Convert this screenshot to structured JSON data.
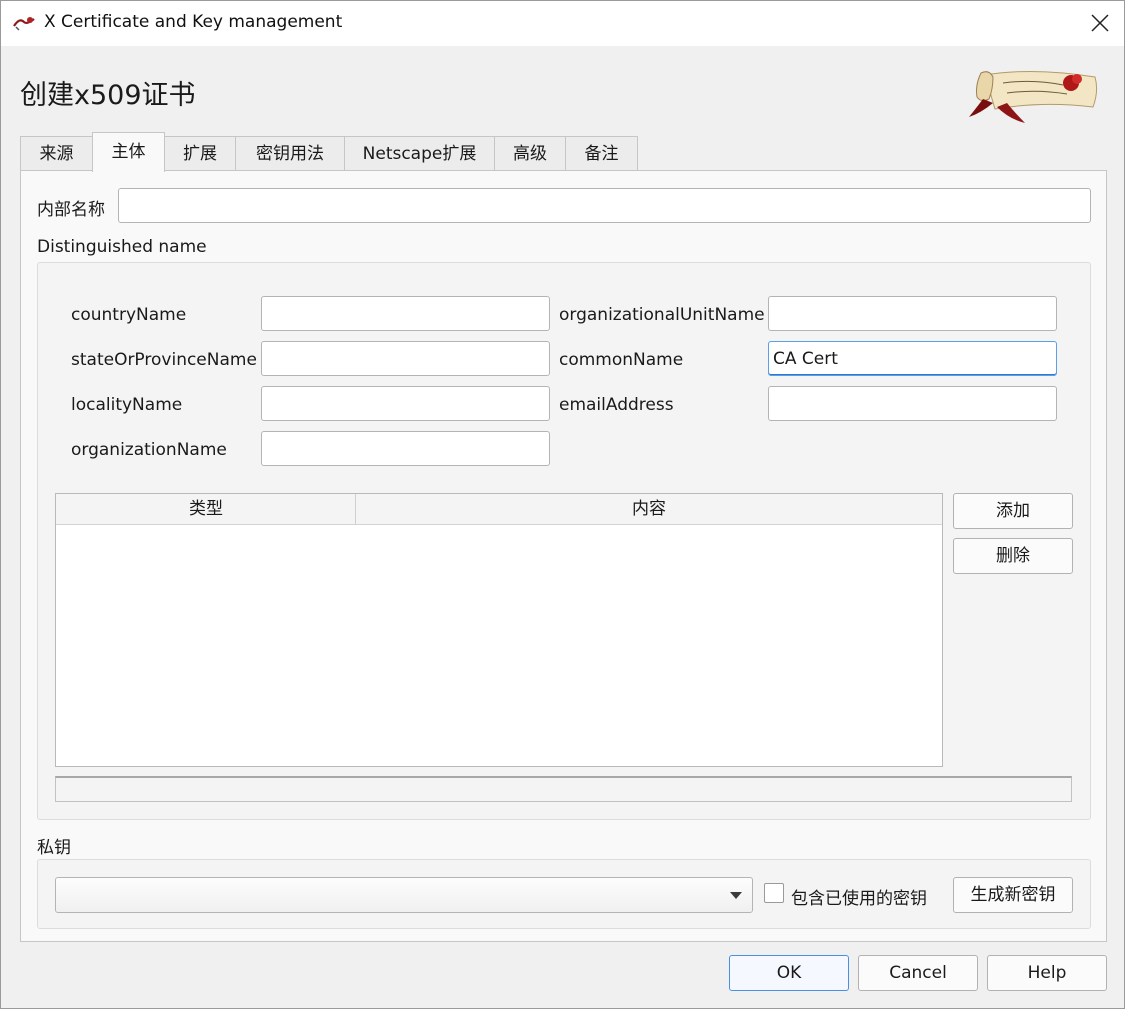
{
  "window": {
    "title": "X Certificate and Key management"
  },
  "dialog": {
    "heading": "创建x509证书"
  },
  "tabs": [
    "来源",
    "主体",
    "扩展",
    "密钥用法",
    "Netscape扩展",
    "高级",
    "备注"
  ],
  "subject": {
    "internal_name_label": "内部名称",
    "internal_name_value": "",
    "dn_title": "Distinguished name",
    "fields_left": [
      {
        "label": "countryName",
        "value": ""
      },
      {
        "label": "stateOrProvinceName",
        "value": ""
      },
      {
        "label": "localityName",
        "value": ""
      },
      {
        "label": "organizationName",
        "value": ""
      }
    ],
    "fields_right": [
      {
        "label": "organizationalUnitName",
        "value": ""
      },
      {
        "label": "commonName",
        "value": "CA Cert"
      },
      {
        "label": "emailAddress",
        "value": ""
      }
    ],
    "table_columns": [
      "类型",
      "内容"
    ],
    "add_button": "添加",
    "delete_button": "删除"
  },
  "private_key": {
    "title": "私钥",
    "selected": "",
    "include_used_label": "包含已使用的密钥",
    "include_used_checked": false,
    "generate_button": "生成新密钥"
  },
  "footer": {
    "ok": "OK",
    "cancel": "Cancel",
    "help": "Help"
  }
}
